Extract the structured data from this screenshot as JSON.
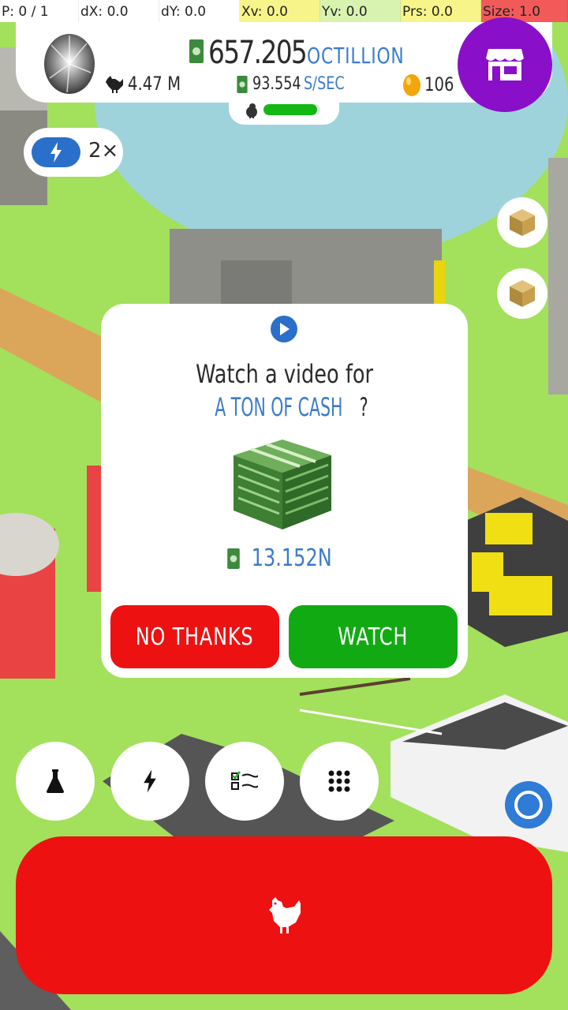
{
  "debug": {
    "p": "P: 0 / 1",
    "dx": "dX: 0.0",
    "dy": "dY: 0.0",
    "xv": "Xv: 0.0",
    "yv": "Yv: 0.0",
    "prs": "Prs: 0.0",
    "size": "Size: 1.0"
  },
  "header": {
    "money_value": "657.205",
    "money_unit": "OCTILLION",
    "chickens": "4.47 M",
    "rate_value": "93.554",
    "rate_unit": "S/SEC",
    "golden_eggs": "106",
    "progress_fraction": 0.95
  },
  "boost": {
    "multiplier": "2×"
  },
  "modal": {
    "line1": "Watch a video for",
    "highlight": "A TON OF CASH",
    "question_mark": "?",
    "reward": "13.152N",
    "no_label": "NO THANKS",
    "watch_label": "WATCH"
  },
  "icons": {
    "egg": "silver-egg-icon",
    "shop": "shop-icon",
    "chicken": "chicken-icon",
    "cash": "cash-icon",
    "golden_egg": "golden-egg-icon",
    "boost": "lightning-icon",
    "crate": "crate-icon",
    "research": "flask-icon",
    "boosts": "lightning-icon",
    "missions": "checklist-icon",
    "menu": "grid-icon",
    "camera": "target-icon",
    "hatch": "chicken-icon"
  },
  "colors": {
    "accent_blue": "#3b7bc8",
    "hatch_red": "#ee1111",
    "watch_green": "#12aa12",
    "shop_purple": "#8a0fc9",
    "debug_yellow": "#f7f58a",
    "debug_green": "#d8f3b0",
    "debug_red": "#f25a5a"
  }
}
